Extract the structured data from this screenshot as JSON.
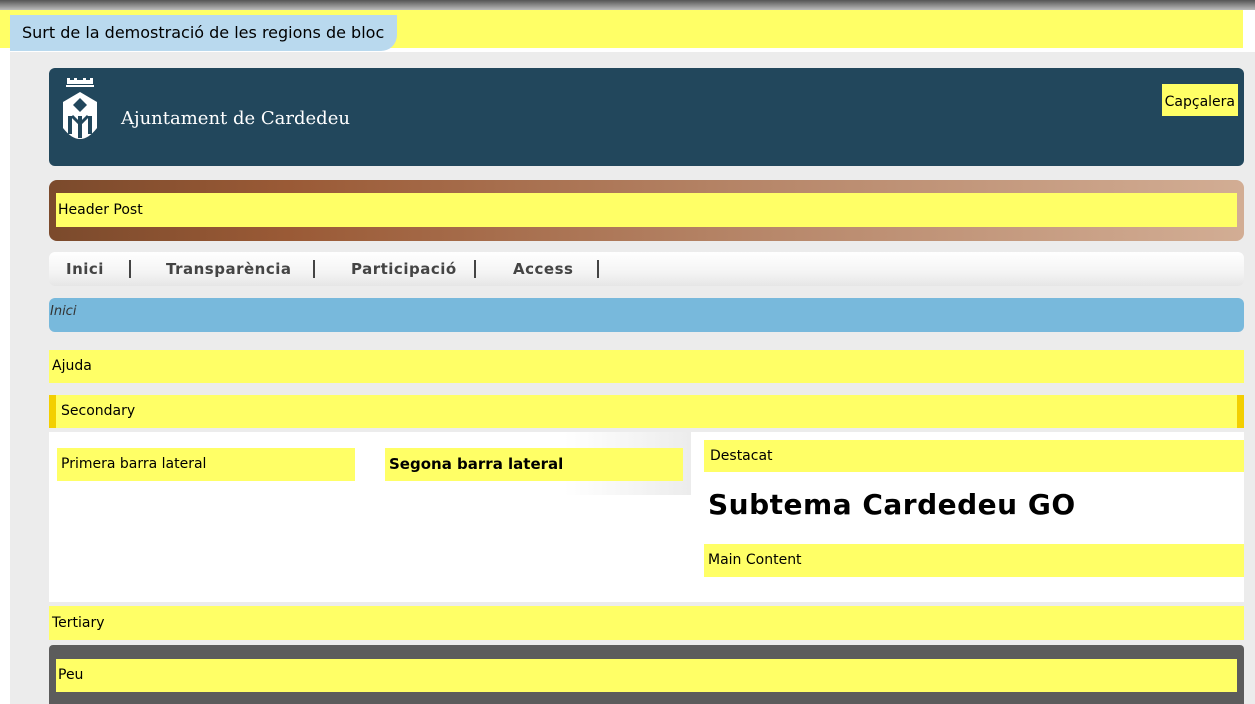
{
  "demo_bar": {
    "exit_label": "Surt de la demostració de les regions de bloc"
  },
  "header": {
    "site_name": "Ajuntament de Cardedeu",
    "region_label": "Capçalera",
    "logo_icon": "cardedeu-coat-of-arms-icon"
  },
  "header_post": {
    "label": "Header Post"
  },
  "nav": {
    "items": [
      {
        "label": "Inici"
      },
      {
        "label": "Transparència"
      },
      {
        "label": "Participació"
      },
      {
        "label": "Access"
      }
    ]
  },
  "breadcrumb": {
    "label": "Inici"
  },
  "regions": {
    "help": "Ajuda",
    "secondary": "Secondary",
    "sidebar_first": "Primera barra lateral",
    "sidebar_second": "Segona barra lateral",
    "highlighted": "Destacat",
    "main_content": "Main Content",
    "tertiary": "Tertiary",
    "footer": "Peu"
  },
  "page_title": "Subtema Cardedeu GO",
  "colors": {
    "region_highlight": "#ffff66",
    "header_bg": "#22475c",
    "breadcrumb_bg": "#78b9dc",
    "footer_bg": "#5c5c5c",
    "secondary_border": "#f3cf00"
  }
}
